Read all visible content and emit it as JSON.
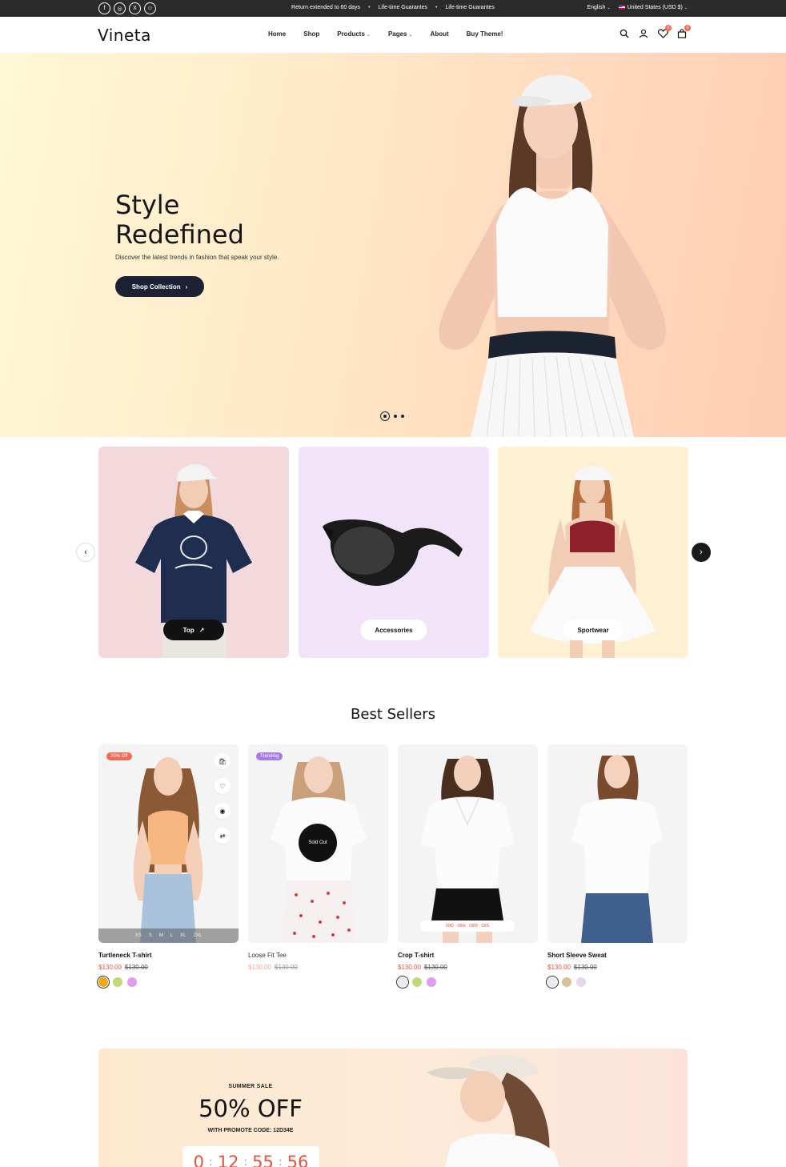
{
  "topbar": {
    "socials": [
      {
        "icon": "facebook-icon",
        "glyph": "f"
      },
      {
        "icon": "instagram-icon",
        "glyph": "◎"
      },
      {
        "icon": "x-icon",
        "glyph": "X"
      },
      {
        "icon": "snapchat-icon",
        "glyph": "☺"
      }
    ],
    "announcements": [
      "Return extended to 60 days",
      "Life-time Guarantes",
      "Life-time Guarantes"
    ],
    "language": "English",
    "currency": "United States (USD $)"
  },
  "header": {
    "logo": "Vineta",
    "nav": [
      {
        "label": "Home",
        "dropdown": false
      },
      {
        "label": "Shop",
        "dropdown": false
      },
      {
        "label": "Products",
        "dropdown": true
      },
      {
        "label": "Pages",
        "dropdown": true
      },
      {
        "label": "About",
        "dropdown": false
      },
      {
        "label": "Buy Theme!",
        "dropdown": false
      }
    ],
    "wishlist_count": "0",
    "cart_count": "0"
  },
  "hero": {
    "title_line1": "Style",
    "title_line2": "Redefined",
    "subtitle": "Discover the latest trends in fashion that speak your style.",
    "button": "Shop Collection"
  },
  "categories": [
    {
      "label": "Top",
      "bg": "#f3d9dc"
    },
    {
      "label": "Accessories",
      "bg": "#f1e3f8"
    },
    {
      "label": "Sportwear",
      "bg": "#fdf0d3"
    }
  ],
  "best_sellers": {
    "title": "Best Sellers",
    "products": [
      {
        "name": "Turtleneck T-shirt",
        "price": "$130.00",
        "old_price": "$130.00",
        "tag": "20% Off",
        "tag_color": "#f06c56",
        "sizes": [
          "XS",
          "S",
          "M",
          "L",
          "XL",
          "2XL"
        ],
        "swatches": [
          "#f3a712",
          "#c2d97a",
          "#e19cf0"
        ]
      },
      {
        "name": "Loose Fit Tee",
        "price": "$130.00",
        "old_price": "$130.00",
        "tag": "Trending",
        "tag_color": "#a77be8",
        "sold_out": "Sold Out",
        "swatches": []
      },
      {
        "name": "Crop T-shirt",
        "price": "$130.00",
        "old_price": "$130.00",
        "countdown": "09D : 09H : 09M : 09S",
        "swatches": [
          "#e8ecf2",
          "#c2d97a",
          "#e19cf0"
        ]
      },
      {
        "name": "Short Sleeve Sweat",
        "price": "$130.00",
        "old_price": "$130.00",
        "swatches": [
          "#e8ecf2",
          "#d7c39a",
          "#e4d6ec"
        ]
      }
    ]
  },
  "banner": {
    "kicker": "SUMMER SALE",
    "headline": "50% OFF",
    "code_label": "WITH PROMOTE CODE:  12D34E",
    "timer": [
      "0",
      "12",
      "55",
      "56"
    ]
  }
}
